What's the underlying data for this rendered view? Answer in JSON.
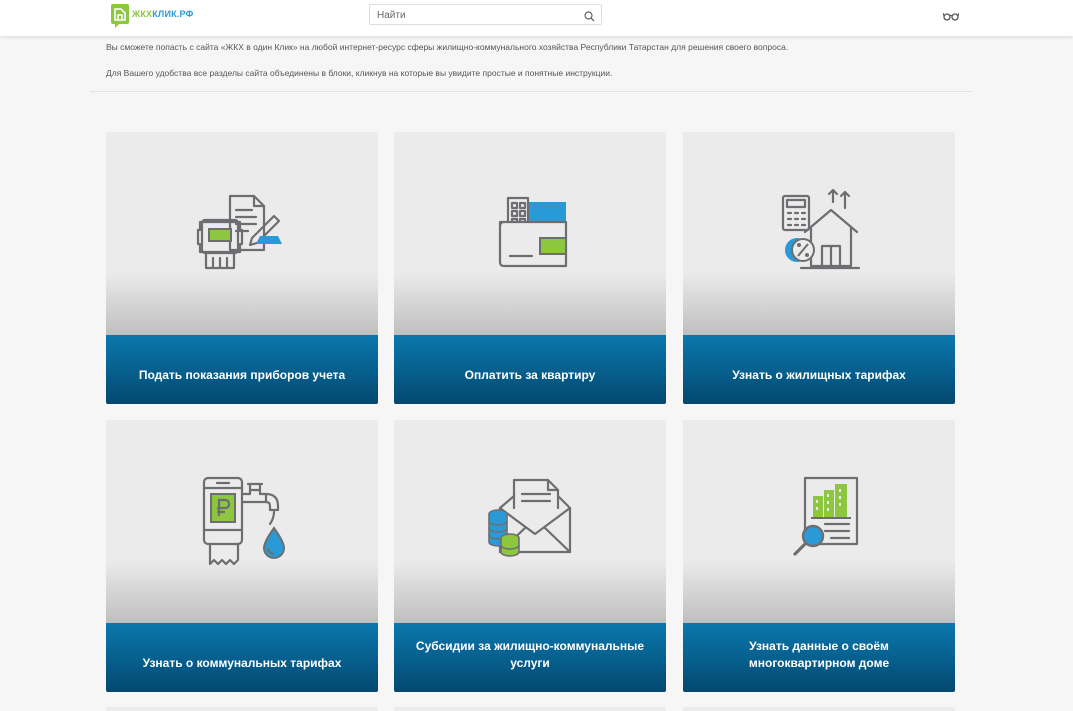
{
  "header": {
    "logo": {
      "text_part1": "ЖКХ",
      "text_part2": "КЛИК.РФ"
    },
    "search": {
      "placeholder": "Найти"
    },
    "accessibility_icon": "glasses-icon"
  },
  "intro": {
    "line1": "Вы сможете попасть с сайта «ЖКХ в один Клик» на любой интернет-ресурс сферы жилищно-коммунального хозяйства Республики Татарстан для решения своего вопроса.",
    "line2": "Для Вашего удобства все разделы сайта объединены в блоки, кликнув на которые вы увидите простые и понятные инструкции."
  },
  "colors": {
    "accent_blue": "#0b78ad",
    "accent_green": "#8dc63f",
    "icon_gray": "#6d6e71",
    "icon_blue": "#2a9ad6"
  },
  "cards": [
    {
      "label": "Подать показания приборов учета",
      "icon": "meter-readings-icon"
    },
    {
      "label": "Оплатить за квартиру",
      "icon": "wallet-icon"
    },
    {
      "label": "Узнать о жилищных тарифах",
      "icon": "house-tariffs-icon"
    },
    {
      "label": "Узнать о коммунальных тарифах",
      "icon": "utility-tariffs-icon"
    },
    {
      "label": "Субсидии за жилищно-коммунальные услуги",
      "icon": "subsidies-icon"
    },
    {
      "label": "Узнать данные о своём многоквартирном доме",
      "icon": "building-data-icon"
    }
  ]
}
